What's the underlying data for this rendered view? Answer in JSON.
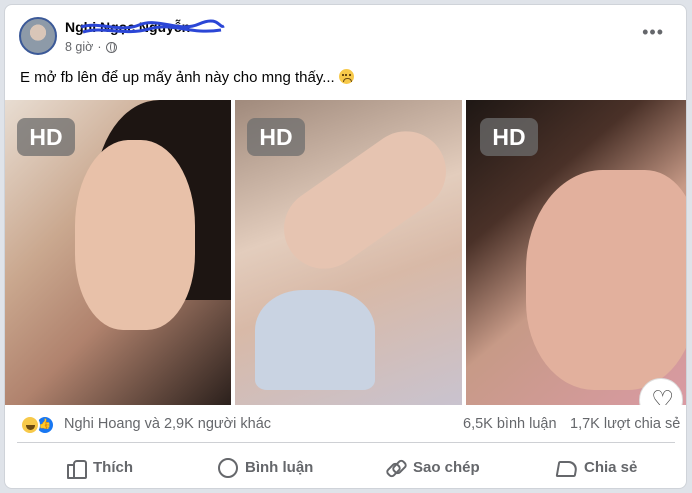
{
  "post": {
    "author": "Nghi Ngọc Nguyễn",
    "time": "8 giờ",
    "privacy_icon": "globe-icon",
    "more_icon": "more-options-icon",
    "caption": "E mở fb lên để up mấy ảnh này cho mng thấy..."
  },
  "photos": [
    {
      "badge": "HD"
    },
    {
      "badge": "HD"
    },
    {
      "badge": "HD"
    }
  ],
  "stats": {
    "reaction_icons": [
      "haha-icon",
      "like-icon"
    ],
    "reactions_text": "Nghi Hoang và 2,9K người khác",
    "comments": "6,5K bình luận",
    "shares": "1,7K lượt chia sẻ"
  },
  "actions": {
    "like": "Thích",
    "comment": "Bình luận",
    "copy": "Sao chép",
    "share": "Chia sẻ"
  },
  "colors": {
    "brand_blue": "#1877f2",
    "text_secondary": "#65676b",
    "text_primary": "#050505"
  }
}
